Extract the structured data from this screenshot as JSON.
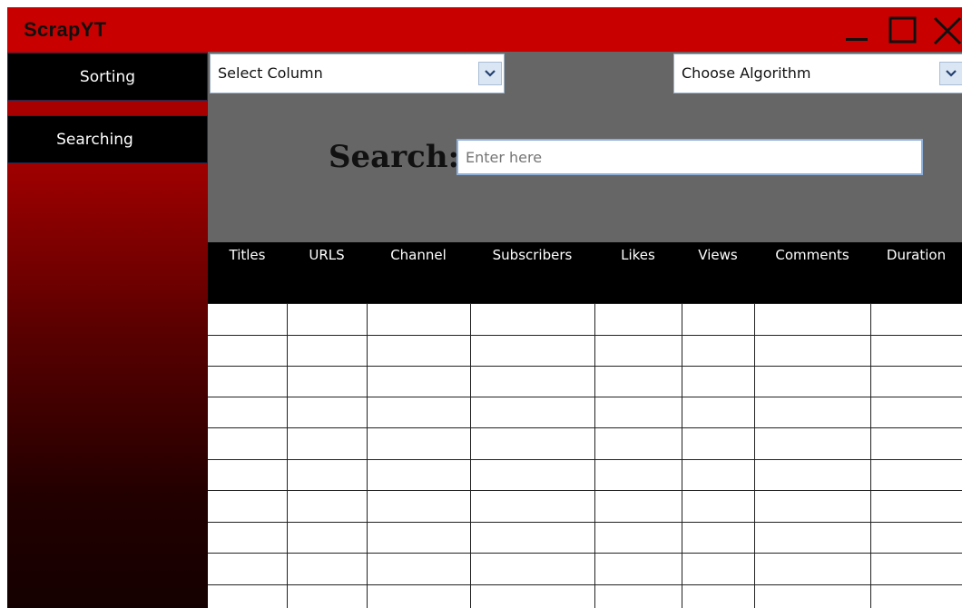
{
  "app": {
    "title": "ScrapYT"
  },
  "window_controls": {
    "minimize": "minimize-icon",
    "maximize": "maximize-icon",
    "close": "close-icon"
  },
  "sidebar": {
    "items": [
      {
        "label": "Sorting"
      },
      {
        "label": "Searching"
      }
    ]
  },
  "controls": {
    "column_select": {
      "value": "Select Column"
    },
    "algorithm_select": {
      "value": "Choose Algorithm"
    },
    "search_label": "Search:",
    "search_placeholder": "Enter here"
  },
  "table": {
    "columns": [
      "Titles",
      "URLS",
      "Channel",
      "Subscribers",
      "Likes",
      "Views",
      "Comments",
      "Duration"
    ],
    "rows": []
  },
  "colors": {
    "titlebar": "#c90000",
    "sidebar_top": "#b00000",
    "sidebar_bottom": "#150000",
    "panel": "#666666",
    "header": "#000000"
  }
}
